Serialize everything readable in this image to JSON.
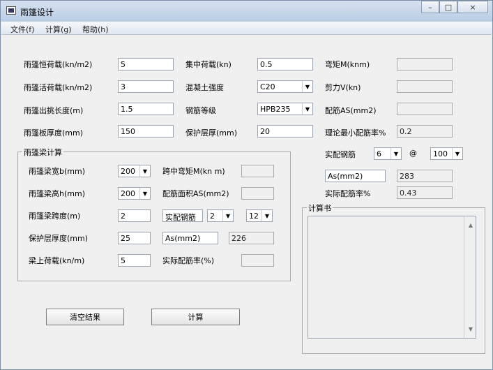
{
  "window": {
    "title": "雨篷设计",
    "min": "□",
    "max": "□",
    "close": "×"
  },
  "menu": [
    "文件(f)",
    "计算(g)",
    "帮助(h)"
  ],
  "top_left": [
    {
      "label": "雨篷恒荷载(kn/m2)",
      "value": "5"
    },
    {
      "label": "雨篷活荷载(kn/m2)",
      "value": "3"
    },
    {
      "label": "雨篷出挑长度(m)",
      "value": "1.5"
    },
    {
      "label": "雨篷板厚度(mm)",
      "value": "150"
    }
  ],
  "top_middle": [
    {
      "label": "集中荷载(kn)",
      "value": "0.5",
      "type": "input"
    },
    {
      "label": "混凝土强度",
      "value": "C20",
      "type": "select"
    },
    {
      "label": "钢筋等级",
      "value": "HPB235",
      "type": "select"
    },
    {
      "label": "保护层厚(mm)",
      "value": "20",
      "type": "input"
    }
  ],
  "top_right": [
    {
      "label": "弯矩M(knm)",
      "value": ""
    },
    {
      "label": "剪力V(kn)",
      "value": ""
    },
    {
      "label": "配筋AS(mm2)",
      "value": ""
    },
    {
      "label": "理论最小配筋率%",
      "value": "0.2"
    }
  ],
  "reinforcement": {
    "label": "实配钢筋",
    "diameter": "6",
    "at": "@",
    "spacing": "100",
    "as_label": "As(mm2)",
    "as_value": "283",
    "ratio_label": "实际配筋率%",
    "ratio_value": "0.43"
  },
  "beam_group": {
    "title": "雨篷梁计算",
    "left": [
      {
        "label": "雨篷梁宽b(mm)",
        "value": "200",
        "type": "select"
      },
      {
        "label": "雨篷梁高h(mm)",
        "value": "200",
        "type": "select"
      },
      {
        "label": "雨篷梁跨度(m)",
        "value": "2",
        "type": "input"
      },
      {
        "label": "保护层厚度(mm)",
        "value": "25",
        "type": "input"
      },
      {
        "label": "梁上荷载(kn/m)",
        "value": "5",
        "type": "input"
      }
    ],
    "right": {
      "span_moment_label": "跨中弯矩M(kn m)",
      "span_moment_value": "",
      "rebar_area_label": "配筋面积AS(mm2)",
      "rebar_area_value": "",
      "rebar_label": "实配钢筋",
      "rebar_count": "2",
      "rebar_diameter": "12",
      "as_label": "As(mm2)",
      "as_value": "226",
      "actual_ratio_label": "实际配筋率(%)",
      "actual_ratio_value": ""
    }
  },
  "calc_book": {
    "title": "计算书",
    "content": ""
  },
  "buttons": {
    "clear": "清空结果",
    "calculate": "计算"
  }
}
